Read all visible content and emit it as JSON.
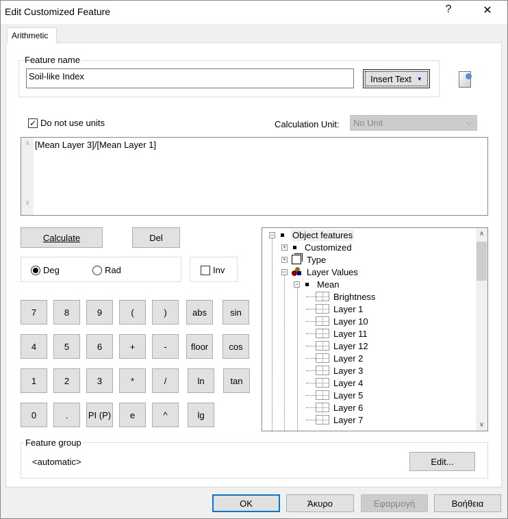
{
  "window": {
    "title": "Edit Customized Feature",
    "help": "?",
    "close": "✕"
  },
  "tabs": [
    {
      "label": "Arithmetic"
    }
  ],
  "feature_name": {
    "label": "Feature name",
    "value": "Soil-like Index",
    "insert_text": "Insert Text",
    "insert_arrow": "▼"
  },
  "units": {
    "do_not_use_units_label": "Do not use units",
    "do_not_use_units_checked": true,
    "calc_unit_label": "Calculation Unit:",
    "calc_unit_value": "No Unit",
    "chevron": "⌵"
  },
  "expression": {
    "value": "[Mean Layer 3]/[Mean Layer 1]"
  },
  "actions": {
    "calculate": "Calculate",
    "del": "Del"
  },
  "angle": {
    "deg": "Deg",
    "rad": "Rad",
    "selected": "Deg",
    "inv": "Inv",
    "inv_checked": false
  },
  "keypad": [
    [
      "7",
      "8",
      "9",
      "(",
      ")",
      "abs",
      "sin"
    ],
    [
      "4",
      "5",
      "6",
      "+",
      "-",
      "floor",
      "cos"
    ],
    [
      "1",
      "2",
      "3",
      "*",
      "/",
      "ln",
      "tan"
    ],
    [
      "0",
      ".",
      "PI (P)",
      "e",
      "^",
      "lg"
    ]
  ],
  "tree": {
    "items": [
      {
        "label": "Object features",
        "level": 0,
        "expander": "−",
        "icon": "square",
        "selected": true
      },
      {
        "label": "Customized",
        "level": 1,
        "expander": "+",
        "icon": "square"
      },
      {
        "label": "Type",
        "level": 1,
        "expander": "+",
        "icon": "stack"
      },
      {
        "label": "Layer Values",
        "level": 1,
        "expander": "−",
        "icon": "layers"
      },
      {
        "label": "Mean",
        "level": 2,
        "expander": "−",
        "icon": "square"
      },
      {
        "label": "Brightness",
        "level": 3,
        "icon": "chart"
      },
      {
        "label": "Layer 1",
        "level": 3,
        "icon": "chart"
      },
      {
        "label": "Layer 10",
        "level": 3,
        "icon": "chart"
      },
      {
        "label": "Layer 11",
        "level": 3,
        "icon": "chart"
      },
      {
        "label": "Layer 12",
        "level": 3,
        "icon": "chart"
      },
      {
        "label": "Layer 2",
        "level": 3,
        "icon": "chart"
      },
      {
        "label": "Layer 3",
        "level": 3,
        "icon": "chart"
      },
      {
        "label": "Layer 4",
        "level": 3,
        "icon": "chart"
      },
      {
        "label": "Layer 5",
        "level": 3,
        "icon": "chart"
      },
      {
        "label": "Layer 6",
        "level": 3,
        "icon": "chart"
      },
      {
        "label": "Layer 7",
        "level": 3,
        "icon": "chart"
      }
    ]
  },
  "feature_group": {
    "label": "Feature group",
    "value": "<automatic>",
    "edit": "Edit..."
  },
  "footer": {
    "ok": "OK",
    "cancel": "Άκυρο",
    "apply": "Εφαρμογή",
    "help": "Βοήθεια"
  }
}
